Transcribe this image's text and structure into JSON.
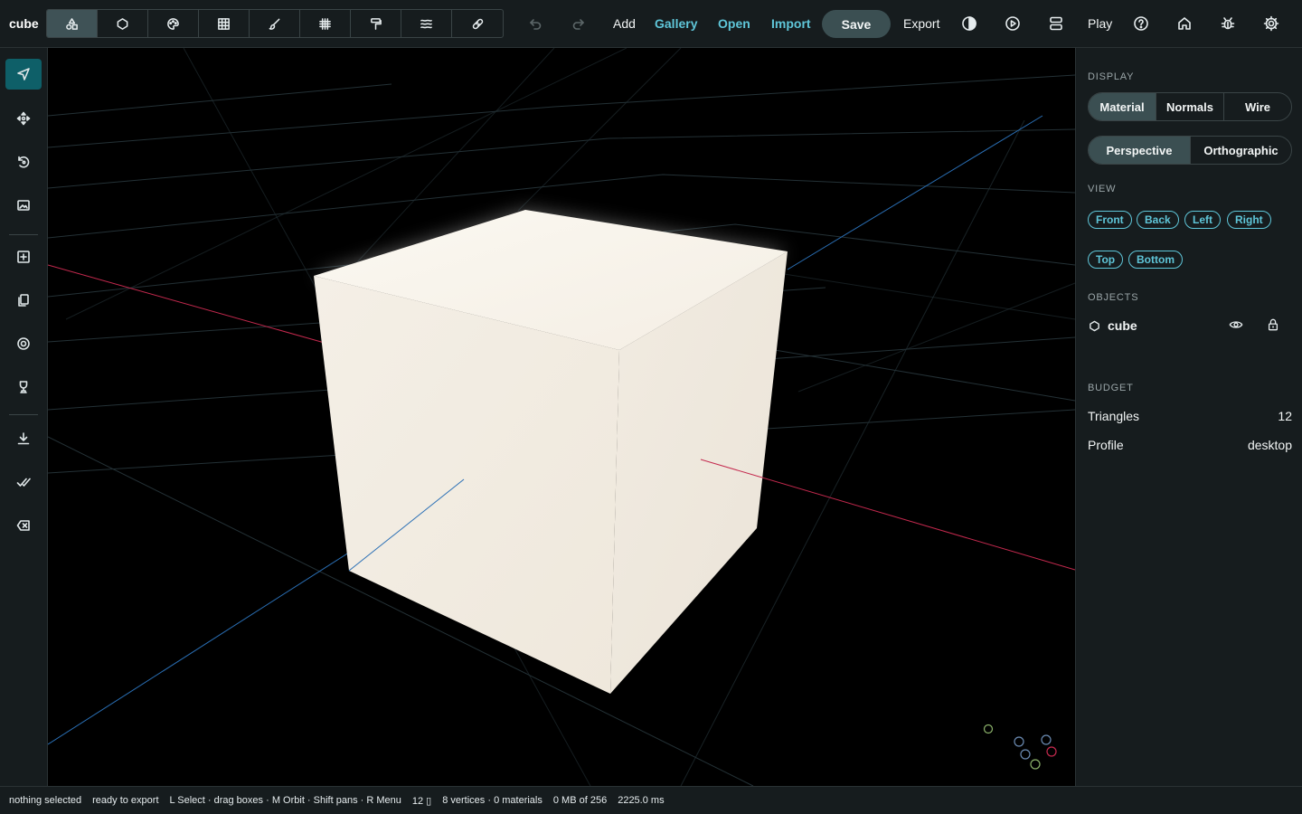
{
  "app": {
    "title": "cube"
  },
  "toolbar": {
    "tools": [
      {
        "icon": "shapes-icon",
        "active": true
      },
      {
        "icon": "circle-icon",
        "active": false
      },
      {
        "icon": "palette-icon",
        "active": false
      },
      {
        "icon": "table-icon",
        "active": false
      },
      {
        "icon": "brush-icon",
        "active": false
      },
      {
        "icon": "grid-icon",
        "active": false
      },
      {
        "icon": "paint-roller-icon",
        "active": false
      },
      {
        "icon": "waves-icon",
        "active": false
      },
      {
        "icon": "bandage-icon",
        "active": false
      }
    ],
    "add_label": "Add",
    "gallery_label": "Gallery",
    "open_label": "Open",
    "import_label": "Import",
    "save_label": "Save",
    "export_label": "Export",
    "play_label": "Play"
  },
  "left_tools": [
    "select-arrow-icon",
    "move-icon",
    "rotate-icon",
    "image-frame-icon",
    "add-box-icon",
    "copy-icon",
    "orbit-target-icon",
    "trophy-icon",
    "download-icon",
    "check-all-icon",
    "clear-icon"
  ],
  "panel": {
    "display_label": "DISPLAY",
    "display_modes": [
      "Material",
      "Normals",
      "Wire"
    ],
    "display_active": "Material",
    "projection_modes": [
      "Perspective",
      "Orthographic"
    ],
    "projection_active": "Perspective",
    "view_label": "VIEW",
    "views_row1": [
      "Front",
      "Back",
      "Left",
      "Right"
    ],
    "views_row2": [
      "Top",
      "Bottom"
    ],
    "objects_label": "OBJECTS",
    "objects": [
      {
        "name": "cube"
      }
    ],
    "budget_label": "BUDGET",
    "triangles_label": "Triangles",
    "triangles_value": "12",
    "profile_label": "Profile",
    "profile_value": "desktop"
  },
  "status": {
    "selection": "nothing selected",
    "export_state": "ready to export",
    "hints": "L Select · drag boxes · M Orbit · Shift pans · R Menu",
    "tri_count": "12 ▯",
    "geometry": "8 vertices · 0 materials",
    "memory": "0 MB of 256",
    "timing": "2225.0 ms"
  },
  "colors": {
    "accent": "#5fc6d9",
    "axis_x": "#c4294e",
    "axis_z": "#2a6fb5",
    "cube": "#f3ede3",
    "panel_bg": "#161c1e"
  }
}
